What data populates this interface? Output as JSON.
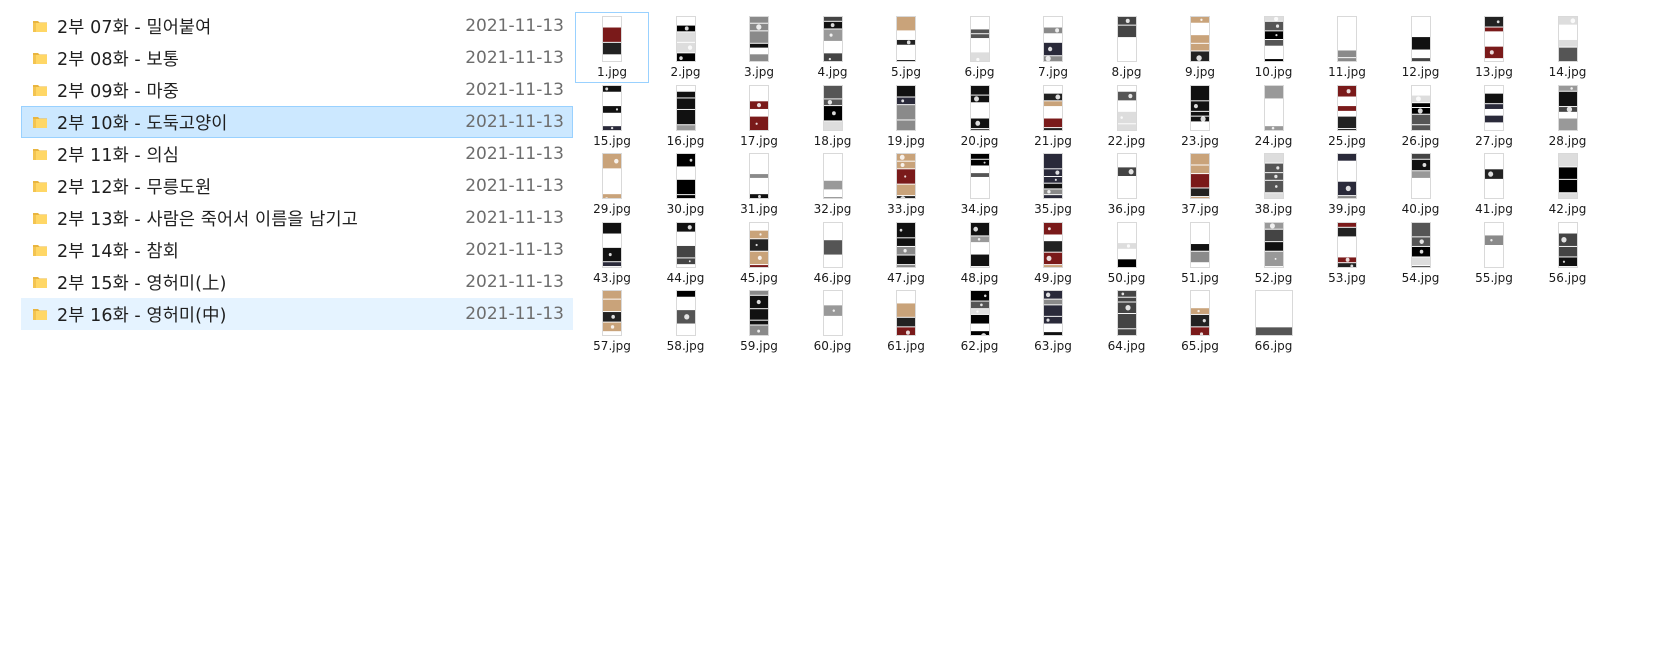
{
  "folders": [
    {
      "name": "2부 07화 - 밀어붙여",
      "date": "2021-11-13",
      "state": ""
    },
    {
      "name": "2부 08화 - 보통",
      "date": "2021-11-13",
      "state": ""
    },
    {
      "name": "2부 09화 - 마중",
      "date": "2021-11-13",
      "state": ""
    },
    {
      "name": "2부 10화 - 도둑고양이",
      "date": "2021-11-13",
      "state": "selected"
    },
    {
      "name": "2부 11화 - 의심",
      "date": "2021-11-13",
      "state": ""
    },
    {
      "name": "2부 12화 - 무릉도원",
      "date": "2021-11-13",
      "state": ""
    },
    {
      "name": "2부 13화 - 사람은 죽어서 이름을 남기고",
      "date": "2021-11-13",
      "state": ""
    },
    {
      "name": "2부 14화 - 참회",
      "date": "2021-11-13",
      "state": ""
    },
    {
      "name": "2부 15화 - 영허미(上)",
      "date": "2021-11-13",
      "state": ""
    },
    {
      "name": "2부 16화 - 영허미(中)",
      "date": "2021-11-13",
      "state": "hover"
    }
  ],
  "files": [
    "1.jpg",
    "2.jpg",
    "3.jpg",
    "4.jpg",
    "5.jpg",
    "6.jpg",
    "7.jpg",
    "8.jpg",
    "9.jpg",
    "10.jpg",
    "11.jpg",
    "12.jpg",
    "13.jpg",
    "14.jpg",
    "15.jpg",
    "16.jpg",
    "17.jpg",
    "18.jpg",
    "19.jpg",
    "20.jpg",
    "21.jpg",
    "22.jpg",
    "23.jpg",
    "24.jpg",
    "25.jpg",
    "26.jpg",
    "27.jpg",
    "28.jpg",
    "29.jpg",
    "30.jpg",
    "31.jpg",
    "32.jpg",
    "33.jpg",
    "34.jpg",
    "35.jpg",
    "36.jpg",
    "37.jpg",
    "38.jpg",
    "39.jpg",
    "40.jpg",
    "41.jpg",
    "42.jpg",
    "43.jpg",
    "44.jpg",
    "45.jpg",
    "46.jpg",
    "47.jpg",
    "48.jpg",
    "49.jpg",
    "50.jpg",
    "51.jpg",
    "52.jpg",
    "53.jpg",
    "54.jpg",
    "55.jpg",
    "56.jpg",
    "57.jpg",
    "58.jpg",
    "59.jpg",
    "60.jpg",
    "61.jpg",
    "62.jpg",
    "63.jpg",
    "64.jpg",
    "65.jpg",
    "66.jpg"
  ],
  "focused_file": "1.jpg",
  "colors": {
    "selected_bg": "#cce8ff",
    "selected_border": "#99d1ff",
    "hover_bg": "#e5f3ff",
    "folder_yellow": "#ffd766",
    "folder_yellow_dark": "#e9b53f"
  }
}
